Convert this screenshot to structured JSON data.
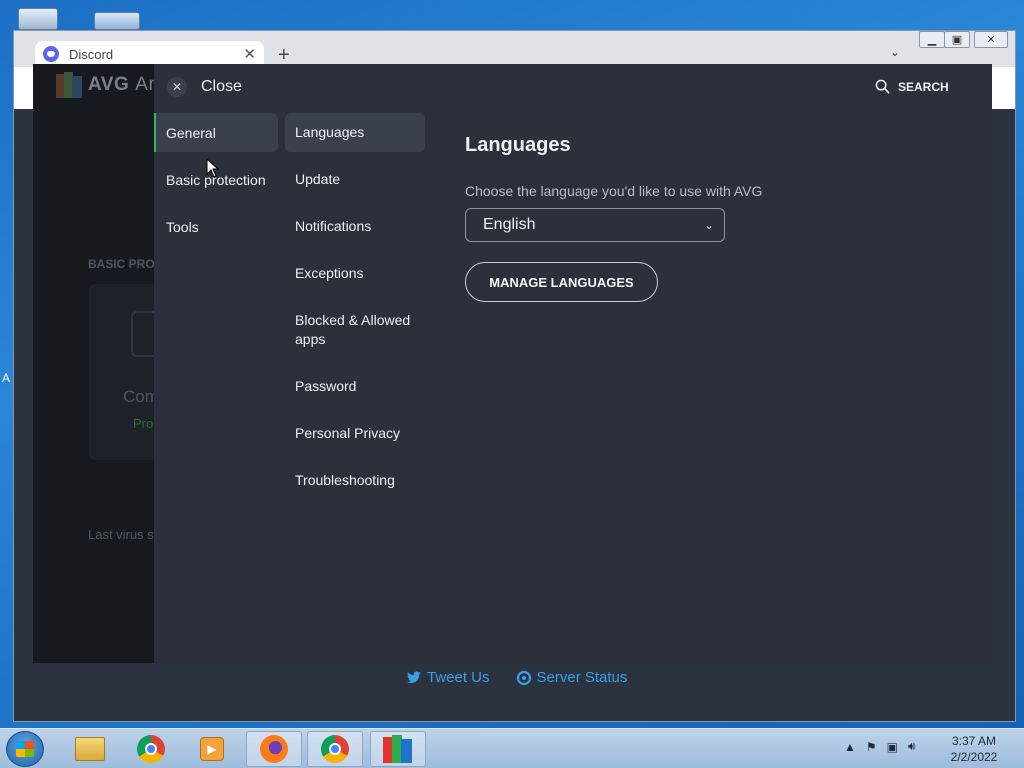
{
  "browser": {
    "tab_title": "Discord",
    "new_tab_label": "+",
    "footer_links": [
      {
        "label": "Tweet Us"
      },
      {
        "label": "Server Status"
      }
    ]
  },
  "avg_background": {
    "logo_text": "AVG",
    "partial_title": "An",
    "section_label": "BASIC PRO",
    "card_title": "Com",
    "card_status": "Pro",
    "bottom_text": "Last virus s"
  },
  "desktop": {
    "edge_letter": "A"
  },
  "settings": {
    "close_label": "Close",
    "search_label": "SEARCH",
    "categories": [
      {
        "label": "General",
        "active": true
      },
      {
        "label": "Basic protection",
        "active": false
      },
      {
        "label": "Tools",
        "active": false
      }
    ],
    "subitems": [
      {
        "label": "Languages",
        "active": true
      },
      {
        "label": "Update",
        "active": false
      },
      {
        "label": "Notifications",
        "active": false
      },
      {
        "label": "Exceptions",
        "active": false
      },
      {
        "label": "Blocked & Allowed apps",
        "active": false
      },
      {
        "label": "Password",
        "active": false
      },
      {
        "label": "Personal Privacy",
        "active": false
      },
      {
        "label": "Troubleshooting",
        "active": false
      }
    ],
    "panel": {
      "title": "Languages",
      "description": "Choose the language you'd like to use with AVG",
      "selected_language": "English",
      "manage_button": "MANAGE LANGUAGES"
    }
  },
  "taskbar": {
    "time": "3:37 AM",
    "date": "2/2/2022",
    "apps": [
      "file-explorer-icon",
      "chrome-icon",
      "media-player-icon",
      "firefox-icon",
      "chrome-icon",
      "avg-icon"
    ]
  },
  "colors": {
    "accent_green": "#2fb56c",
    "modal_bg": "#2b303a",
    "link_blue": "#3a9ee8"
  }
}
